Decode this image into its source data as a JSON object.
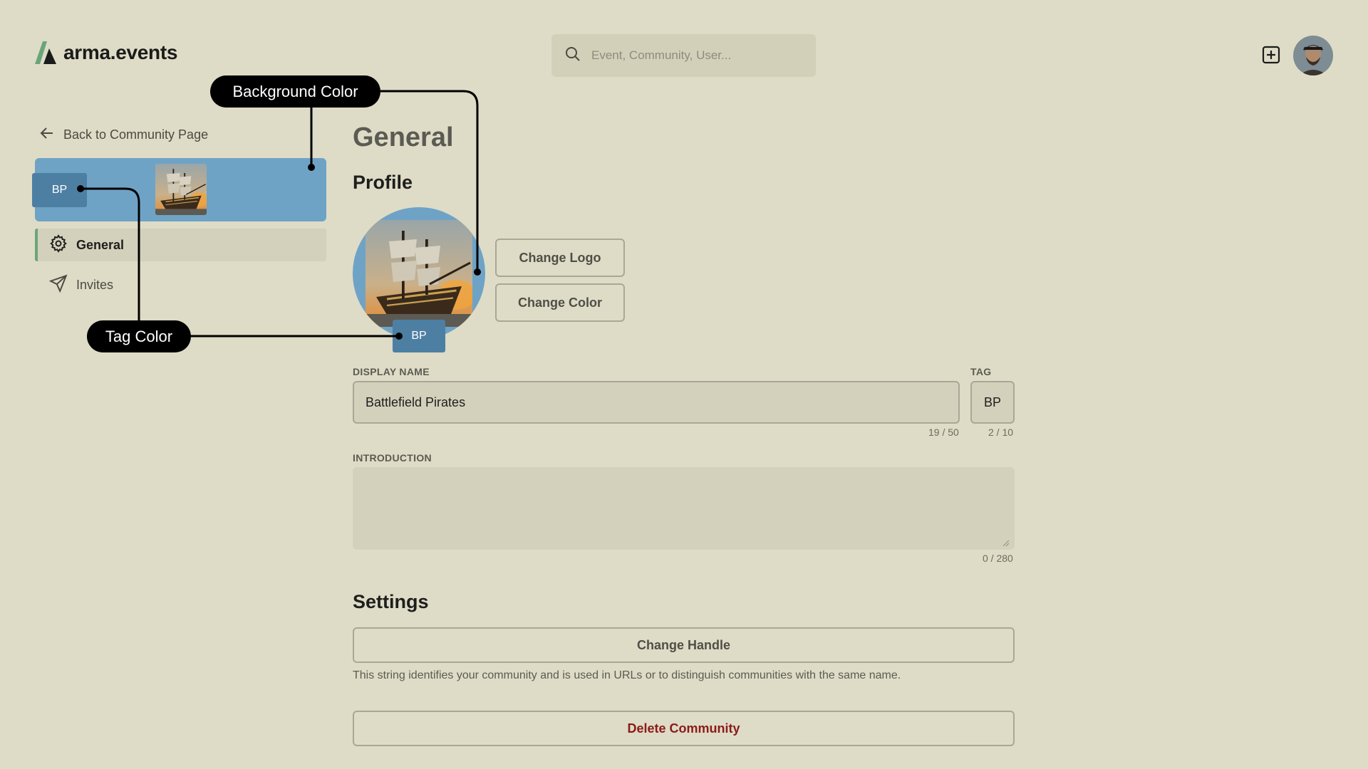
{
  "header": {
    "brand": "arma.events",
    "search_placeholder": "Event, Community, User..."
  },
  "sidebar": {
    "back_label": "Back to Community Page",
    "banner": {
      "tag": "BP",
      "background_color": "#6fa3c6",
      "tag_color": "#4d7fa3"
    },
    "items": [
      {
        "label": "General",
        "icon": "gear-icon",
        "active": true
      },
      {
        "label": "Invites",
        "icon": "send-icon",
        "active": false
      }
    ]
  },
  "annotations": {
    "background_color": "Background Color",
    "tag_color": "Tag Color"
  },
  "main": {
    "title": "General",
    "profile": {
      "heading": "Profile",
      "logo_tag": "BP",
      "change_logo": "Change Logo",
      "change_color": "Change Color"
    },
    "display_name": {
      "label": "DISPLAY NAME",
      "value": "Battlefield Pirates",
      "counter": "19 / 50"
    },
    "tag": {
      "label": "TAG",
      "value": "BP",
      "counter": "2 / 10"
    },
    "introduction": {
      "label": "INTRODUCTION",
      "value": "",
      "counter": "0 / 280"
    },
    "settings": {
      "heading": "Settings",
      "change_handle": "Change Handle",
      "handle_help": "This string identifies your community and is used in URLs or to distinguish communities with the same name.",
      "delete": "Delete Community"
    }
  },
  "colors": {
    "page_background": "#dedcc6",
    "accent_green": "#6aa57a",
    "danger": "#8b1a1a"
  }
}
